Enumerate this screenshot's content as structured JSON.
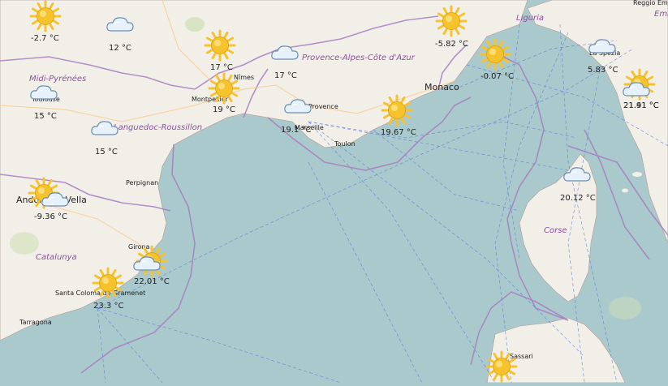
{
  "map": {
    "colors": {
      "sea": "#aac9cc",
      "land": "#f2efe9",
      "region_border": "#a77fc0",
      "shipping_route": "#5b7fd9",
      "sun": "#f7c32c",
      "cloud": "#e6f1fb"
    },
    "regions": [
      {
        "id": "midi",
        "label": "Midi-Pyrénées"
      },
      {
        "id": "langue",
        "label": "Languedoc-Roussillon"
      },
      {
        "id": "paca",
        "label": "Provence-Alpes-Côte d'Azur"
      },
      {
        "id": "liguria",
        "label": "Liguria"
      },
      {
        "id": "catalunya",
        "label": "Catalunya"
      },
      {
        "id": "corse",
        "label": "Corse"
      },
      {
        "id": "emilia",
        "label": "Emi"
      }
    ],
    "cities": [
      {
        "id": "monaco",
        "label": "Monaco"
      },
      {
        "id": "toulouse",
        "label": "Toulouse"
      },
      {
        "id": "montpellier",
        "label": "Montpellier"
      },
      {
        "id": "nimes",
        "label": "Nîmes"
      },
      {
        "id": "provence",
        "label": "Provence"
      },
      {
        "id": "marseille",
        "label": "Marseille"
      },
      {
        "id": "toulon",
        "label": "Toulon"
      },
      {
        "id": "perpignan",
        "label": "Perpignan"
      },
      {
        "id": "andorra",
        "label": "Andorra la Vella"
      },
      {
        "id": "girona",
        "label": "Girona"
      },
      {
        "id": "santacoloma",
        "label": "Santa Coloma de Gramenet"
      },
      {
        "id": "tarragona",
        "label": "Tarragona"
      },
      {
        "id": "laspezia",
        "label": "La Spezia"
      },
      {
        "id": "sassari",
        "label": "Sassari"
      },
      {
        "id": "reggio",
        "label": "Reggio Emilia"
      }
    ],
    "weather": [
      {
        "id": "w1",
        "icon": "sun",
        "temp": "-2.7 °C"
      },
      {
        "id": "w2",
        "icon": "cloud",
        "temp": "12 °C"
      },
      {
        "id": "w3",
        "icon": "sun",
        "temp": "17 °C"
      },
      {
        "id": "w4",
        "icon": "cloud",
        "temp": "17 °C"
      },
      {
        "id": "w5",
        "icon": "sun",
        "temp": "-5.82 °C"
      },
      {
        "id": "w6",
        "icon": "sun",
        "temp": "-0.07 °C"
      },
      {
        "id": "w7",
        "icon": "cloud",
        "temp": "5.83 °C"
      },
      {
        "id": "w8",
        "icon": "sun",
        "temp": "21.91 °C"
      },
      {
        "id": "w9",
        "icon": "cloud",
        "temp": "21.41 °C"
      },
      {
        "id": "w10",
        "icon": "cloud",
        "temp": "15 °C"
      },
      {
        "id": "w11",
        "icon": "sun",
        "temp": "19 °C"
      },
      {
        "id": "w12",
        "icon": "cloud",
        "temp": "19.1 °C"
      },
      {
        "id": "w13",
        "icon": "sun",
        "temp": "19.67 °C"
      },
      {
        "id": "w14",
        "icon": "cloud",
        "temp": "15 °C"
      },
      {
        "id": "w15",
        "icon": "cloud",
        "temp": "20.12 °C"
      },
      {
        "id": "w16",
        "icon": "sun",
        "temp": ""
      },
      {
        "id": "w17",
        "icon": "cloud",
        "temp": "-9.36 °C"
      },
      {
        "id": "w18",
        "icon": "sun",
        "temp": "22.01 °C"
      },
      {
        "id": "w19",
        "icon": "cloud",
        "temp": ""
      },
      {
        "id": "w20",
        "icon": "sun",
        "temp": "23.3 °C"
      },
      {
        "id": "w21",
        "icon": "sun",
        "temp": ""
      }
    ]
  }
}
